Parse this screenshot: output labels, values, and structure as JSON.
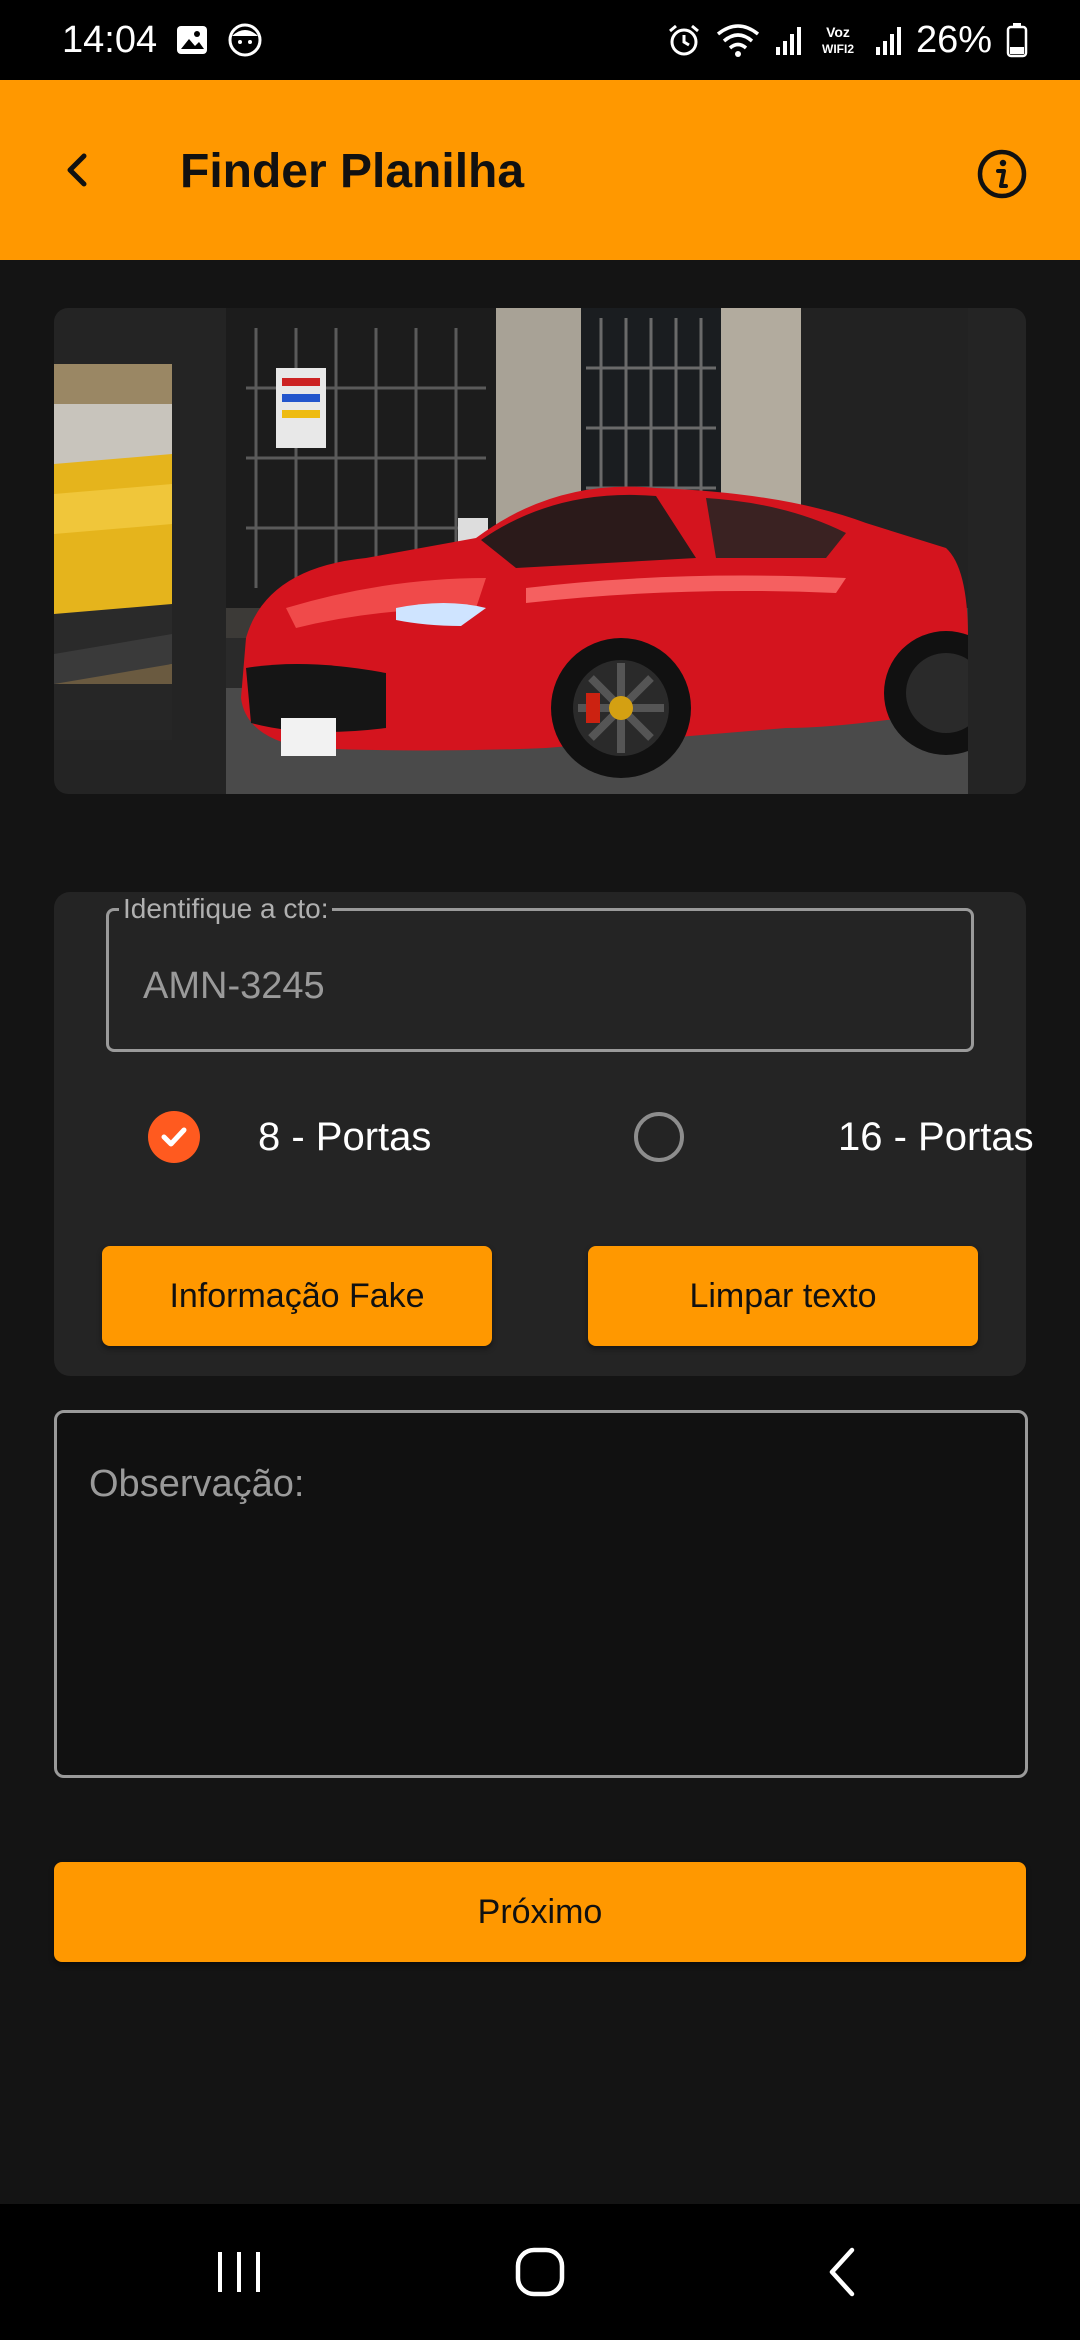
{
  "status_bar": {
    "time": "14:04",
    "battery": "26%",
    "icons": [
      "gallery-icon",
      "face-icon",
      "alarm-icon",
      "wifi-icon",
      "signal-icon",
      "volte-icon",
      "signal-icon",
      "battery-icon"
    ],
    "volte_text": "Voz\nWIFI2"
  },
  "app_bar": {
    "title": "Finder Planilha",
    "back_icon": "chevron-left-icon",
    "info_icon": "info-icon",
    "color": "#ff9800"
  },
  "carousel": {
    "images": [
      "yellow-sports-car",
      "red-ferrari-sports-car"
    ]
  },
  "form": {
    "cto_label": "Identifique a cto:",
    "cto_value": "AMN-3245",
    "options": [
      {
        "label": "8 - Portas",
        "selected": true
      },
      {
        "label": "16 - Portas",
        "selected": false
      }
    ],
    "fake_button": "Informação Fake",
    "clear_button": "Limpar texto"
  },
  "observation": {
    "placeholder": "Observação:"
  },
  "next_button": "Próximo",
  "nav_bar": {
    "icons": [
      "recents-icon",
      "home-icon",
      "back-icon"
    ]
  }
}
